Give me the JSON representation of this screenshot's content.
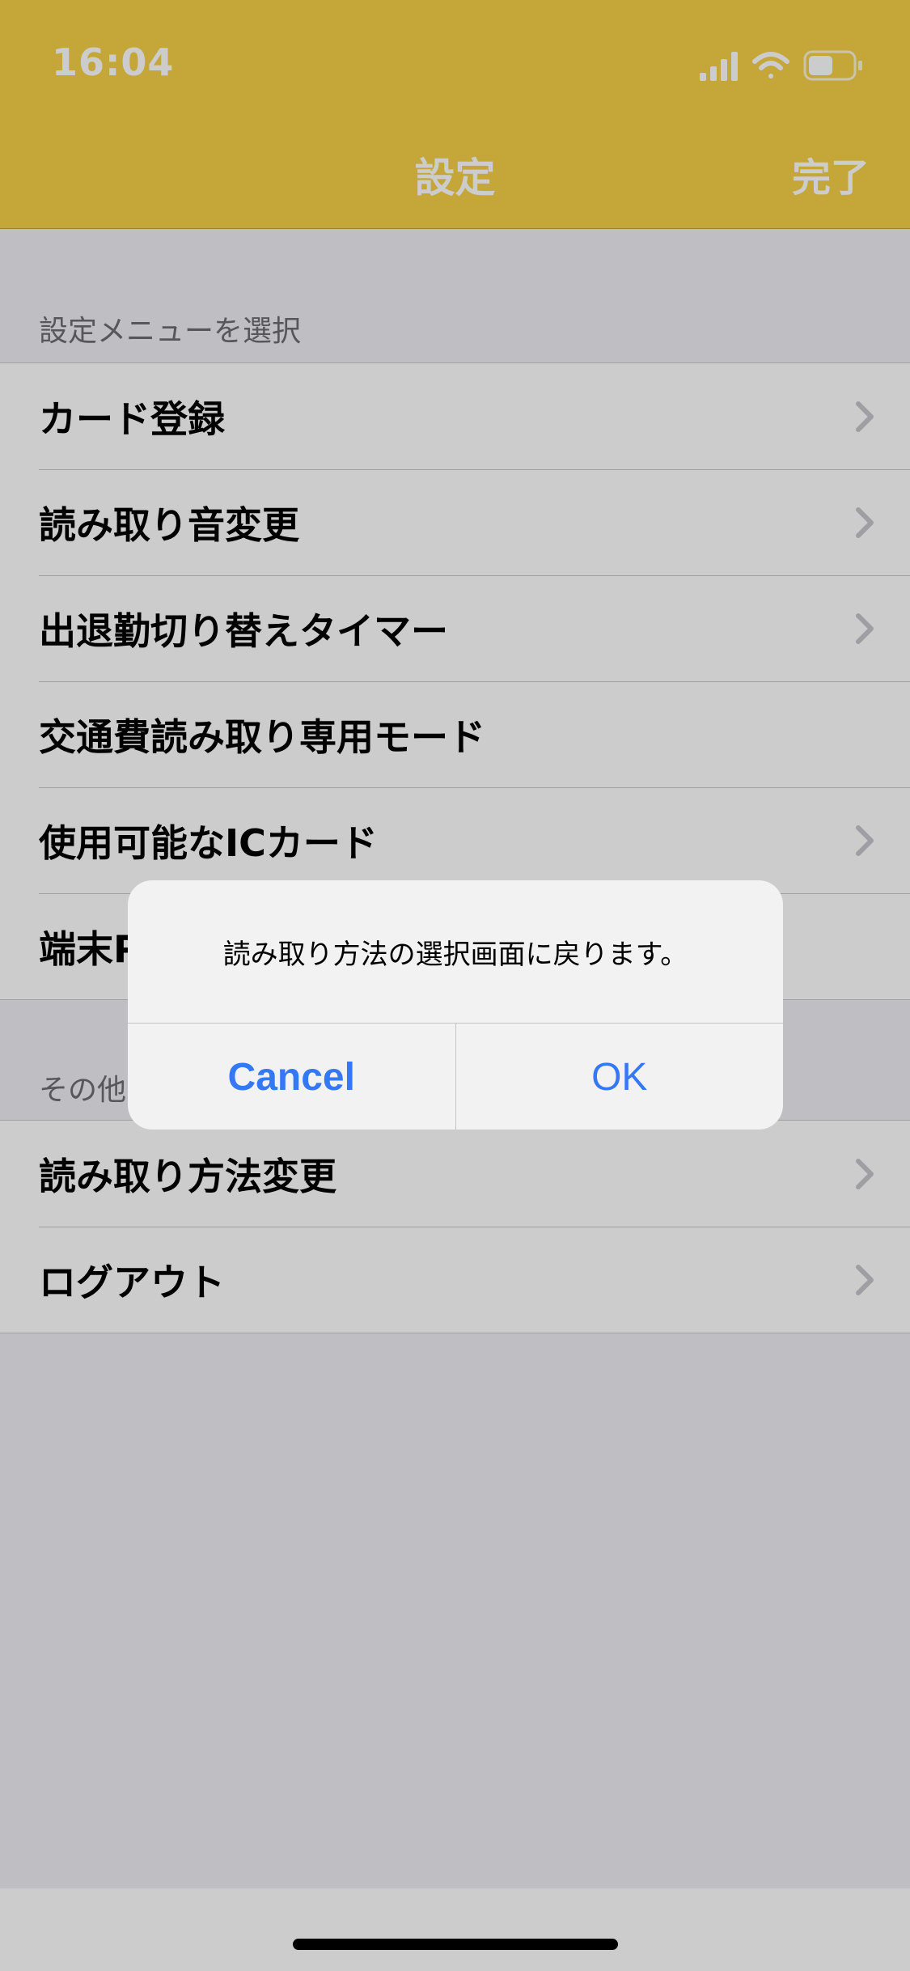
{
  "status_bar": {
    "time": "16:04",
    "signal_icon": "cellular-signal-icon",
    "wifi_icon": "wifi-icon",
    "battery_icon": "battery-icon",
    "battery_level": 0.55
  },
  "nav": {
    "title": "設定",
    "done_label": "完了"
  },
  "colors": {
    "header": "#f6d147",
    "link": "#3478f6",
    "background": "#efeff4"
  },
  "sections": [
    {
      "title": "設定メニューを選択",
      "items": [
        {
          "label": "カード登録",
          "chevron": true
        },
        {
          "label": "読み取り音変更",
          "chevron": true
        },
        {
          "label": "出退勤切り替えタイマー",
          "chevron": true
        },
        {
          "label": "交通費読み取り専用モード",
          "chevron": false
        },
        {
          "label": "使用可能なICカード",
          "chevron": true
        },
        {
          "label": "端末P",
          "chevron": false
        }
      ]
    },
    {
      "title": "その他",
      "items": [
        {
          "label": "読み取り方法変更",
          "chevron": true
        },
        {
          "label": "ログアウト",
          "chevron": true
        }
      ]
    }
  ],
  "alert": {
    "message": "読み取り方法の選択画面に戻ります。",
    "cancel_label": "Cancel",
    "ok_label": "OK"
  }
}
